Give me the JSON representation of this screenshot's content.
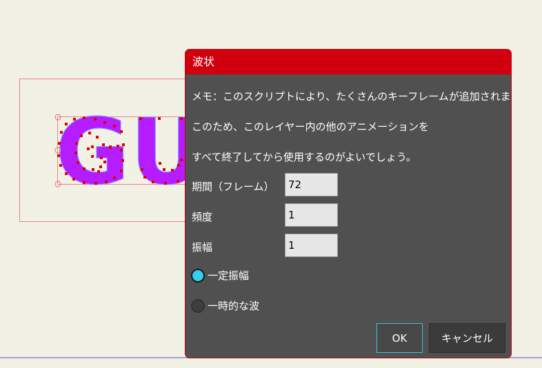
{
  "dialog": {
    "title": "波状",
    "notes": [
      "メモ：このスクリプトにより、たくさんのキーフレームが追加されます。",
      "このため、このレイヤー内の他のアニメーションを",
      "すべて終了してから使用するのがよいでしょう。"
    ],
    "fields": [
      {
        "label": "期間（フレーム）",
        "value": "72"
      },
      {
        "label": "頻度",
        "value": "1"
      },
      {
        "label": "振幅",
        "value": "1"
      }
    ],
    "radios": [
      {
        "label": "一定振幅",
        "selected": true
      },
      {
        "label": "一時的な波",
        "selected": false
      }
    ],
    "ok_label": "OK",
    "cancel_label": "キャンセル"
  },
  "canvas": {
    "text": "GU",
    "text_color": "#b51cff",
    "handle_color": "#e00000",
    "bbox_color": "#f08080"
  }
}
